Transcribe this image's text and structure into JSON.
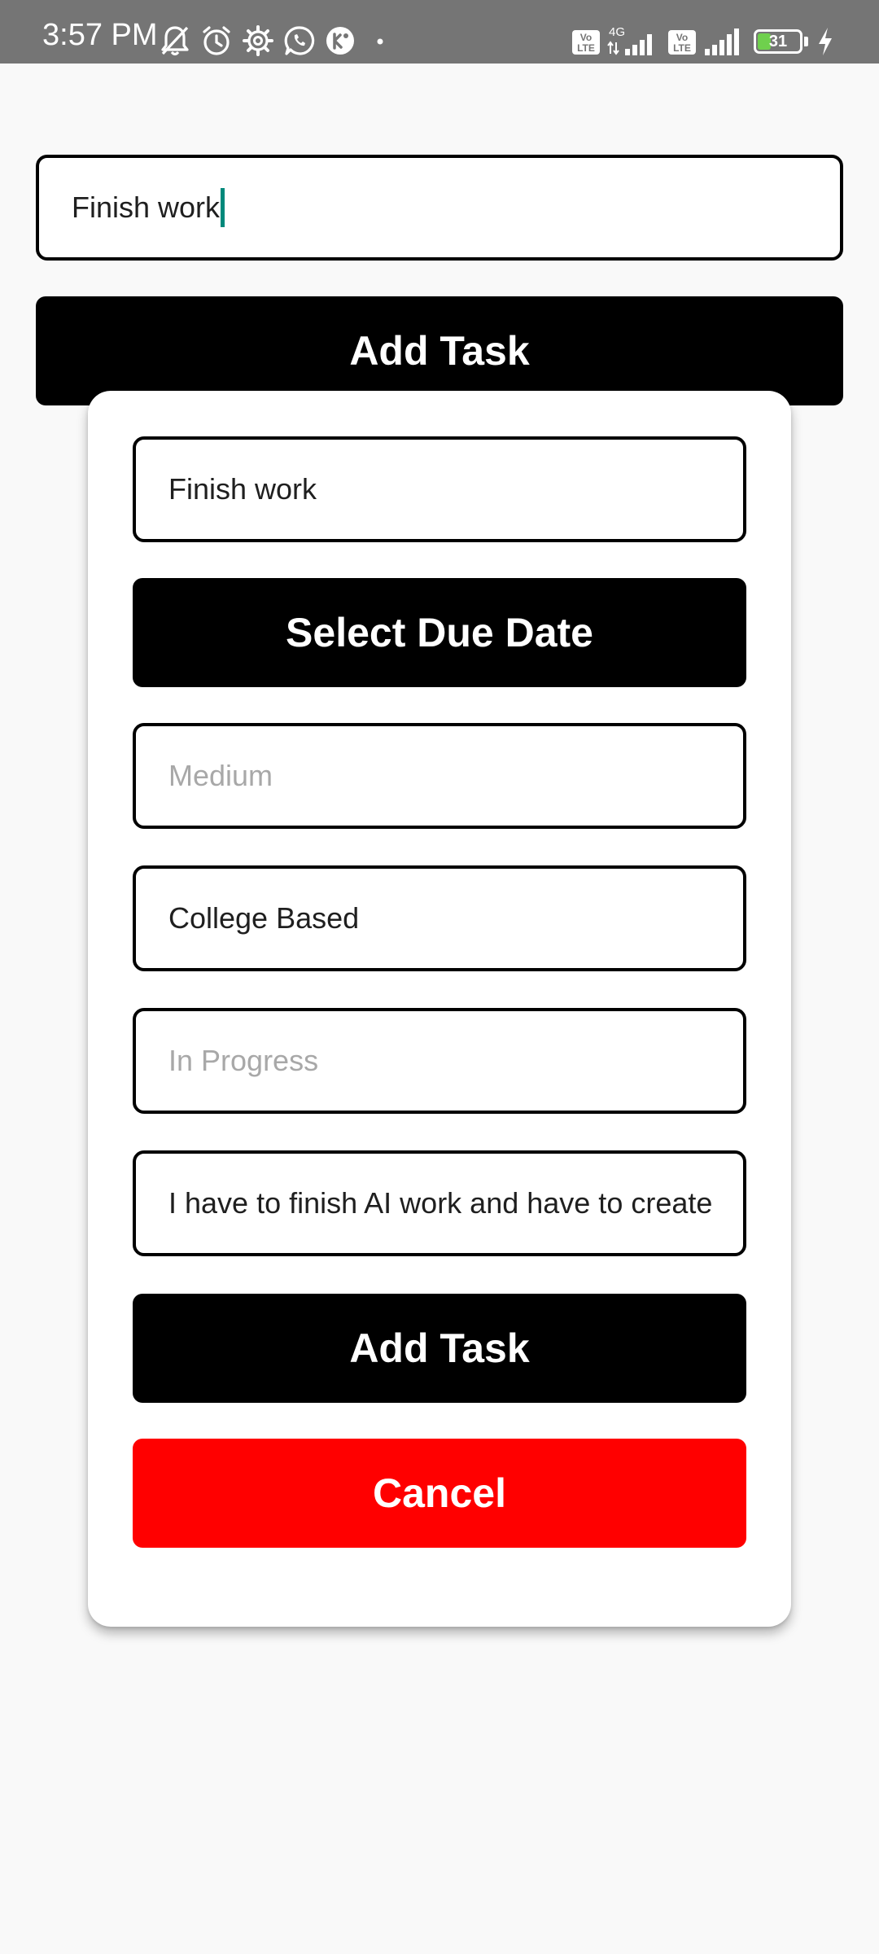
{
  "status_bar": {
    "time": "3:57 PM",
    "icons_left": [
      "notifications-off-icon",
      "alarm-icon",
      "settings-icon",
      "whatsapp-icon",
      "app-notification-icon",
      "dot-icon"
    ],
    "icons_right": [
      "volte-icon",
      "signal-4g-icon",
      "volte-icon",
      "signal-icon"
    ],
    "network_type": "4G",
    "volte_label": "Vo LTE",
    "battery_level": "31",
    "charging": true
  },
  "main": {
    "task_input_value": "Finish work",
    "add_task_label": "Add Task"
  },
  "modal": {
    "title_value": "Finish work",
    "select_due_date_label": "Select Due Date",
    "priority_placeholder": "Medium",
    "category_value": "College Based",
    "status_placeholder": "In Progress",
    "description_value": "I have to finish AI work and have to create",
    "add_task_label": "Add Task",
    "cancel_label": "Cancel"
  },
  "colors": {
    "status_bar_bg": "#757575",
    "background": "#f9f9f9",
    "primary_button": "#000000",
    "cancel_button": "#ff0000",
    "caret": "#00897b",
    "placeholder_text": "#a8a8a8",
    "battery_fill": "#6fd04d"
  }
}
